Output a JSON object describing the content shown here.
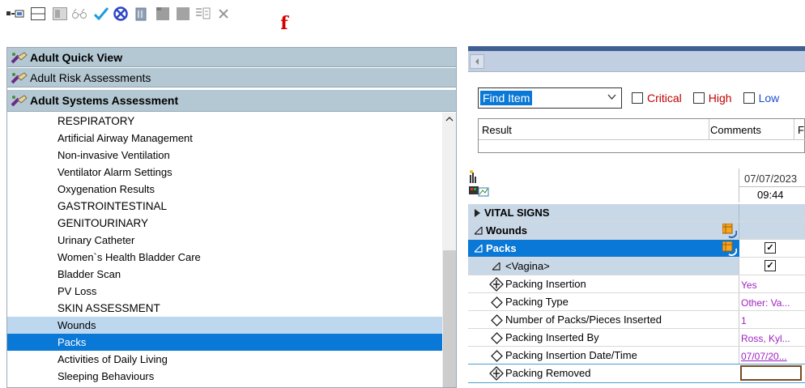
{
  "toolbar": {
    "icons": [
      "grid-toggle-icon",
      "view-layout-icon",
      "table-icon",
      "glasses-icon",
      "checkmark-icon",
      "cancel-circle-icon",
      "trash-icon",
      "square-icon",
      "square-icon-2",
      "document-icon",
      "close-icon",
      "required-marker-icon"
    ],
    "required_glyph": "f"
  },
  "bands": [
    {
      "label": "Adult Quick View",
      "bold": true
    },
    {
      "label": "Adult Risk Assessments",
      "bold": false
    },
    {
      "label": "Adult Systems Assessment",
      "bold": true
    }
  ],
  "list": {
    "items": [
      {
        "label": "RESPIRATORY",
        "state": "normal"
      },
      {
        "label": "Artificial Airway Management",
        "state": "normal"
      },
      {
        "label": "Non-invasive Ventilation",
        "state": "normal"
      },
      {
        "label": "Ventilator Alarm Settings",
        "state": "normal"
      },
      {
        "label": "Oxygenation Results",
        "state": "normal"
      },
      {
        "label": "GASTROINTESTINAL",
        "state": "normal"
      },
      {
        "label": "GENITOURINARY",
        "state": "normal"
      },
      {
        "label": "Urinary Catheter",
        "state": "normal"
      },
      {
        "label": "Women`s Health Bladder Care",
        "state": "normal"
      },
      {
        "label": "Bladder Scan",
        "state": "normal"
      },
      {
        "label": "PV Loss",
        "state": "normal"
      },
      {
        "label": "SKIN ASSESSMENT",
        "state": "normal"
      },
      {
        "label": "Wounds",
        "state": "highlighted"
      },
      {
        "label": "Packs",
        "state": "selected"
      },
      {
        "label": "Activities of Daily Living",
        "state": "normal"
      },
      {
        "label": "Sleeping Behaviours",
        "state": "normal"
      }
    ]
  },
  "filter": {
    "find_item": "Find Item",
    "critical": "Critical",
    "high": "High",
    "low": "Low"
  },
  "result_grid": {
    "col_result": "Result",
    "col_comments": "Comments",
    "col_third": "F"
  },
  "flowsheet": {
    "date": "07/07/2023",
    "time": "09:44",
    "sections": {
      "vital_signs": "VITAL SIGNS",
      "wounds": "Wounds",
      "packs": "Packs",
      "vagina": "<Vagina>"
    },
    "rows": [
      {
        "label": "Packing Insertion",
        "value": "Yes",
        "underline": false,
        "required": true
      },
      {
        "label": "Packing Type",
        "value": "Other: Va...",
        "underline": false,
        "required": false
      },
      {
        "label": "Number of Packs/Pieces Inserted",
        "value": "1",
        "underline": false,
        "required": false
      },
      {
        "label": "Packing Inserted By",
        "value": "Ross, Kyl...",
        "underline": false,
        "required": false
      },
      {
        "label": "Packing Insertion Date/Time",
        "value": "07/07/20...",
        "underline": true,
        "required": false
      },
      {
        "label": "Packing Removed",
        "value": "",
        "underline": false,
        "required": true
      }
    ],
    "checkmark": "✓"
  },
  "colors": {
    "band": "#b4c8d3",
    "selection": "#0a78d7",
    "highlight": "#bcd7ee",
    "value_text": "#a020c0",
    "critical": "#c00000",
    "low": "#1f4fd1"
  }
}
